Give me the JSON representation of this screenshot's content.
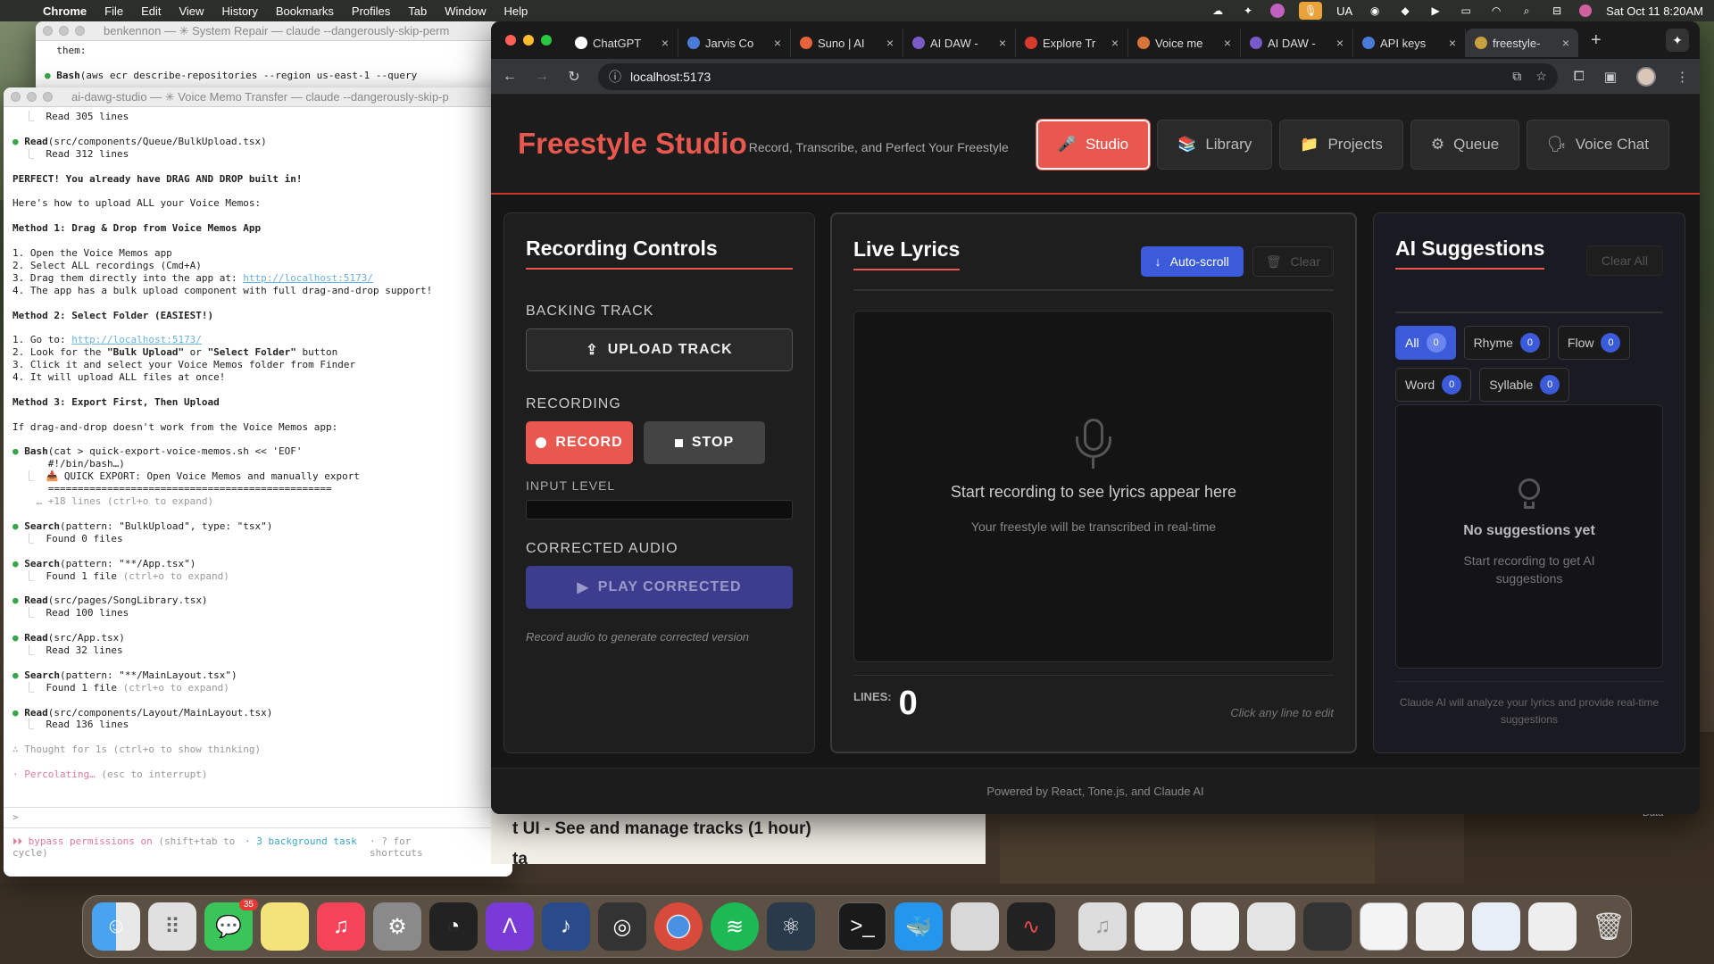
{
  "menubar": {
    "app": "Chrome",
    "items": [
      "File",
      "Edit",
      "View",
      "History",
      "Bookmarks",
      "Profiles",
      "Tab",
      "Window",
      "Help"
    ],
    "status_ua": "UA",
    "clock": "Sat Oct 11  8:20AM"
  },
  "term_back": {
    "title": "benkennon — ✳ System Repair — claude --dangerously-skip-perm",
    "line1": "them:",
    "line2_tool": "Bash",
    "line2": "(aws ecr describe-repositories --region us-east-1 --query"
  },
  "term_front": {
    "title": "ai-dawg-studio — ✳ Voice Memo Transfer — claude --dangerously-skip-p",
    "read305": "Read 305 lines",
    "read_bulk_tool": "Read",
    "read_bulk": "(src/components/Queue/BulkUpload.tsx)",
    "read312": "Read 312 lines",
    "perfect": "PERFECT! You already have DRAG AND DROP built in!",
    "howto": "Here's how to upload ALL your Voice Memos:",
    "m1": "Method 1: Drag & Drop from Voice Memos App",
    "m1_1": "1. Open the Voice Memos app",
    "m1_2": "2. Select ALL recordings (Cmd+A)",
    "m1_3a": "3. Drag them directly into the app at: ",
    "m1_3link": "http://localhost:5173/",
    "m1_4": "4. The app has a bulk upload component with full drag-and-drop support!",
    "m2": "Method 2: Select Folder (EASIEST!)",
    "m2_1a": "1. Go to: ",
    "m2_1link": "http://localhost:5173/",
    "m2_2a": "2. Look for the ",
    "m2_2b": "\"Bulk Upload\"",
    "m2_2c": " or ",
    "m2_2d": "\"Select Folder\"",
    "m2_2e": " button",
    "m2_3": "3. Click it and select your Voice Memos folder from Finder",
    "m2_4": "4. It will upload ALL files at once!",
    "m3": "Method 3: Export First, Then Upload",
    "m3_txt": "If drag-and-drop doesn't work from the Voice Memos app:",
    "bash_tool": "Bash",
    "bash": "(cat > quick-export-voice-memos.sh << 'EOF'",
    "bash_2": "      #!/bin/bash…)",
    "quick": "📥 QUICK EXPORT: Open Voice Memos and manually export",
    "eqline": "      ================================================",
    "expand18": "    … +18 lines (ctrl+o to expand)",
    "s1_tool": "Search",
    "s1": "(pattern: \"BulkUpload\", type: \"tsx\")",
    "s1_r": "Found 0 files",
    "s2_tool": "Search",
    "s2": "(pattern: \"**/App.tsx\")",
    "s2_r": "Found 1 file",
    "expand": "(ctrl+o to expand)",
    "r1_tool": "Read",
    "r1": "(src/pages/SongLibrary.tsx)",
    "r1_r": "Read 100 lines",
    "r2_tool": "Read",
    "r2": "(src/App.tsx)",
    "r2_r": "Read 32 lines",
    "s3_tool": "Search",
    "s3": "(pattern: \"**/MainLayout.tsx\")",
    "s3_r": "Found 1 file",
    "r3_tool": "Read",
    "r3": "(src/components/Layout/MainLayout.tsx)",
    "r3_r": "Read 136 lines",
    "thought": "∴ Thought for 1s (ctrl+o to show thinking)",
    "perc": "· Percolating… ",
    "perc_hint": "(esc to interrupt)",
    "prompt": ">",
    "bypass": "⏵⏵ bypass permissions on ",
    "bypass_hint": "(shift+tab to cycle)",
    "bg_task": "· 3 background task",
    "shortcuts": "· ? for shortcuts"
  },
  "tabs": [
    {
      "label": "ChatGPT",
      "color": "#ffffff"
    },
    {
      "label": "Jarvis Co",
      "color": "#4a7bd8"
    },
    {
      "label": "Suno | AI",
      "color": "#e8633a"
    },
    {
      "label": "AI DAW -",
      "color": "#7a5ac8"
    },
    {
      "label": "Explore Tr",
      "color": "#d83a2e"
    },
    {
      "label": "Voice me",
      "color": "#d8763a"
    },
    {
      "label": "AI DAW -",
      "color": "#7a5ac8"
    },
    {
      "label": "API keys",
      "color": "#4a7bd8"
    },
    {
      "label": "freestyle-",
      "color": "#c8a040"
    }
  ],
  "url": "localhost:5173",
  "app": {
    "brand": "Freestyle Studio",
    "tagline": "Record, Transcribe, and Perfect Your Freestyle",
    "nav": [
      {
        "label": "Studio",
        "icon": "🎤"
      },
      {
        "label": "Library",
        "icon": "📚"
      },
      {
        "label": "Projects",
        "icon": "📁"
      },
      {
        "label": "Queue",
        "icon": "⚙"
      },
      {
        "label": "Voice Chat",
        "icon": "🗣"
      }
    ],
    "recording": {
      "title": "Recording Controls",
      "backing": "BACKING TRACK",
      "upload": "UPLOAD TRACK",
      "recording": "RECORDING",
      "record": "RECORD",
      "stop": "STOP",
      "input_level": "INPUT LEVEL",
      "corrected": "CORRECTED AUDIO",
      "play": "PLAY CORRECTED",
      "hint": "Record audio to generate corrected version"
    },
    "lyrics": {
      "title": "Live Lyrics",
      "autoscroll": "Auto-scroll",
      "clear": "Clear",
      "empty_title": "Start recording to see lyrics appear here",
      "empty_sub": "Your freestyle will be transcribed in real-time",
      "lines_label": "LINES:",
      "lines_count": "0",
      "edit_hint": "Click any line to edit"
    },
    "ai": {
      "title": "AI Suggestions",
      "clear_all": "Clear All",
      "chips": [
        {
          "label": "All",
          "count": "0"
        },
        {
          "label": "Rhyme",
          "count": "0"
        },
        {
          "label": "Flow",
          "count": "0"
        },
        {
          "label": "Word",
          "count": "0"
        },
        {
          "label": "Syllable",
          "count": "0"
        }
      ],
      "empty_title": "No suggestions yet",
      "empty_sub": "Start recording to get AI suggestions",
      "footer_note": "Claude AI will analyze your lyrics and provide real-time suggestions"
    },
    "footer": "Powered by React, Tone.js, and Claude AI"
  },
  "bgdoc": {
    "line1": "t UI - See and manage tracks (1 hour)",
    "line2": "ta ",
    "side": "Data"
  },
  "dock": {
    "messages_badge": "35"
  },
  "colors": {
    "accent": "#e8584f",
    "blue": "#3b5bdb",
    "purple": "#3d3d8f"
  }
}
